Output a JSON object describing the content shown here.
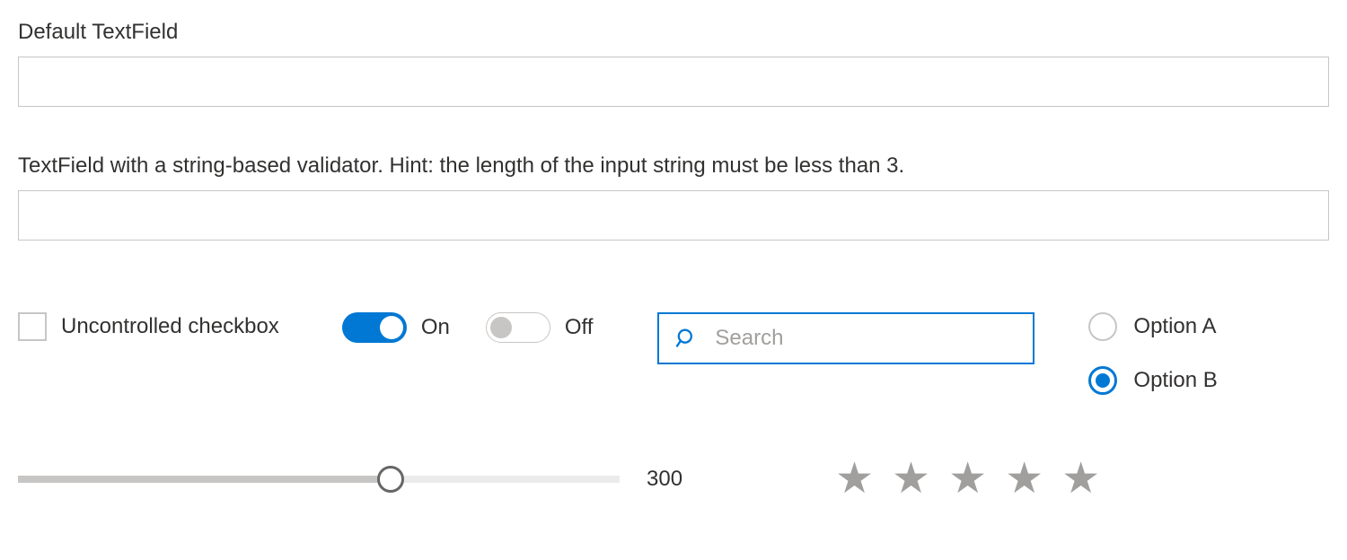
{
  "textfield1": {
    "label": "Default TextField",
    "value": ""
  },
  "textfield2": {
    "label": "TextField with a string-based validator. Hint: the length of the input string must be less than 3.",
    "value": ""
  },
  "checkbox": {
    "label": "Uncontrolled checkbox",
    "checked": false
  },
  "toggle_on": {
    "label": "On",
    "state": true
  },
  "toggle_off": {
    "label": "Off",
    "state": false
  },
  "search": {
    "placeholder": "Search",
    "value": ""
  },
  "radio": {
    "options": [
      {
        "label": "Option A",
        "selected": false
      },
      {
        "label": "Option B",
        "selected": true
      }
    ]
  },
  "slider": {
    "value": "300",
    "min": 0,
    "max": 500
  },
  "rating": {
    "value": 0,
    "max": 5
  },
  "colors": {
    "primary": "#0078d4",
    "border": "#c8c6c4",
    "text": "#323130",
    "muted": "#a19f9d"
  }
}
